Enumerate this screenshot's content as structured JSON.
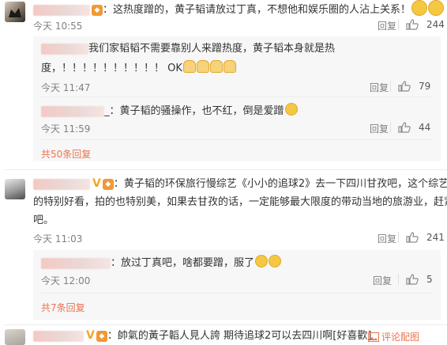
{
  "comments": [
    {
      "text": "：这热度蹭的，黄子韬请放过丁真，不想他和娱乐圈的人沾上关系！",
      "time": "今天 10:55",
      "reply_label": "回复",
      "likes": "244",
      "replies": [
        {
          "text_line1": "我们家韬韬不需要靠别人来蹭热度，黄子韬本身就是热",
          "text_line2": "度，！！！！！！！！！！ OK",
          "time": "今天 11:47",
          "reply_label": "回复",
          "likes": "79"
        },
        {
          "text": "_：黄子韬的骚操作，也不红，倒是爱蹭",
          "time": "今天 11:59",
          "reply_label": "回复",
          "likes": "44"
        }
      ],
      "more_replies": "共50条回复"
    },
    {
      "badge": "V",
      "text_line1": "：黄子韬的环保旅行慢综艺《小小的追球2》去一下四川甘孜吧，这个综艺真",
      "text_line2": "的特别好看，拍的也特别美，如果去甘孜的话，一定能够最大限度的带动当地的旅游业，赶紧去",
      "text_line3": "吧。",
      "time": "今天 11:03",
      "reply_label": "回复",
      "likes": "241",
      "replies": [
        {
          "text": "：放过丁真吧，啥都要蹭，服了",
          "time": "今天 12:00",
          "reply_label": "回复",
          "likes": "5"
        }
      ],
      "more_replies": "共7条回复"
    },
    {
      "badge": "V",
      "text": "：帥氣的黃子韜人見人誇 期待追球2可以去四川啊[好喜歡]",
      "comment_action": "评论配图"
    }
  ],
  "colors": {
    "link": "#eb7350",
    "meta": "#808080",
    "reply_bg": "#f7f7f7",
    "vip": "#f4a526"
  },
  "icons": [
    "thumbs-up-icon",
    "image-icon",
    "vip-badge-icon",
    "medal-icon",
    "emoji-icon"
  ]
}
